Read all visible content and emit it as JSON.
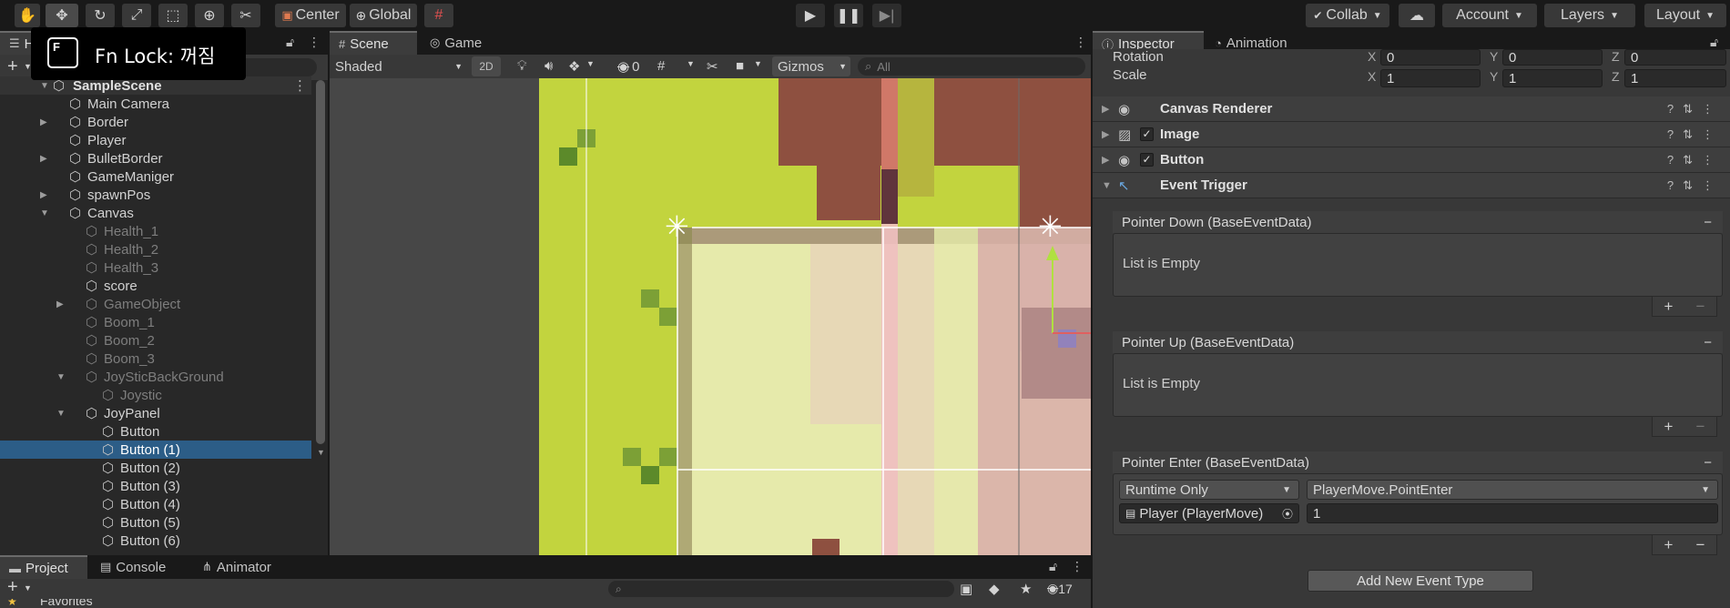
{
  "toolbar": {
    "center_label": "Center",
    "global_label": "Global",
    "collab_label": "Collab",
    "account_label": "Account",
    "layers_label": "Layers",
    "layout_label": "Layout"
  },
  "fn_lock": {
    "key": "F",
    "text": "Fn Lock: 꺼짐"
  },
  "hierarchy": {
    "tab_label": "H",
    "scene_name": "SampleScene",
    "items": [
      {
        "label": "Main Camera"
      },
      {
        "label": "Border"
      },
      {
        "label": "Player"
      },
      {
        "label": "BulletBorder"
      },
      {
        "label": "GameManiger"
      },
      {
        "label": "spawnPos"
      },
      {
        "label": "Canvas"
      },
      {
        "label": "Health_1"
      },
      {
        "label": "Health_2"
      },
      {
        "label": "Health_3"
      },
      {
        "label": "score"
      },
      {
        "label": "GameObject"
      },
      {
        "label": "Boom_1"
      },
      {
        "label": "Boom_2"
      },
      {
        "label": "Boom_3"
      },
      {
        "label": "JoySticBackGround"
      },
      {
        "label": "Joystic"
      },
      {
        "label": "JoyPanel"
      },
      {
        "label": "Button"
      },
      {
        "label": "Button (1)"
      },
      {
        "label": "Button (2)"
      },
      {
        "label": "Button (3)"
      },
      {
        "label": "Button (4)"
      },
      {
        "label": "Button (5)"
      },
      {
        "label": "Button (6)"
      }
    ]
  },
  "scene": {
    "tab_scene": "Scene",
    "tab_game": "Game",
    "shading_mode": "Shaded",
    "mode_2d": "2D",
    "hidden_count": "0",
    "gizmos_label": "Gizmos",
    "search_placeholder": "All"
  },
  "inspector": {
    "tab_inspector": "Inspector",
    "tab_animation": "Animation",
    "rotation_label": "Rotation",
    "scale_label": "Scale",
    "rotation": {
      "x": "0",
      "y": "0",
      "z": "0"
    },
    "scale": {
      "x": "1",
      "y": "1",
      "z": "1"
    },
    "axis": {
      "x": "X",
      "y": "Y",
      "z": "Z"
    },
    "components": [
      {
        "name": "Canvas Renderer"
      },
      {
        "name": "Image"
      },
      {
        "name": "Button"
      },
      {
        "name": "Event Trigger"
      }
    ],
    "events": {
      "pointer_down": "Pointer Down (BaseEventData)",
      "pointer_up": "Pointer Up (BaseEventData)",
      "pointer_enter": "Pointer Enter (BaseEventData)",
      "list_empty": "List is Empty"
    },
    "pointer_enter_entry": {
      "runtime": "Runtime Only",
      "function": "PlayerMove.PointEnter",
      "object": "Player (PlayerMove)",
      "argument": "1"
    },
    "add_event_label": "Add New Event Type"
  },
  "project": {
    "tab_project": "Project",
    "tab_console": "Console",
    "tab_animator": "Animator",
    "favorites": "Favorites",
    "hidden_count": "17"
  },
  "colors": {
    "selection": "#2c5d87",
    "scene_green": "#c2d43e",
    "scene_brown": "#8e5040"
  }
}
